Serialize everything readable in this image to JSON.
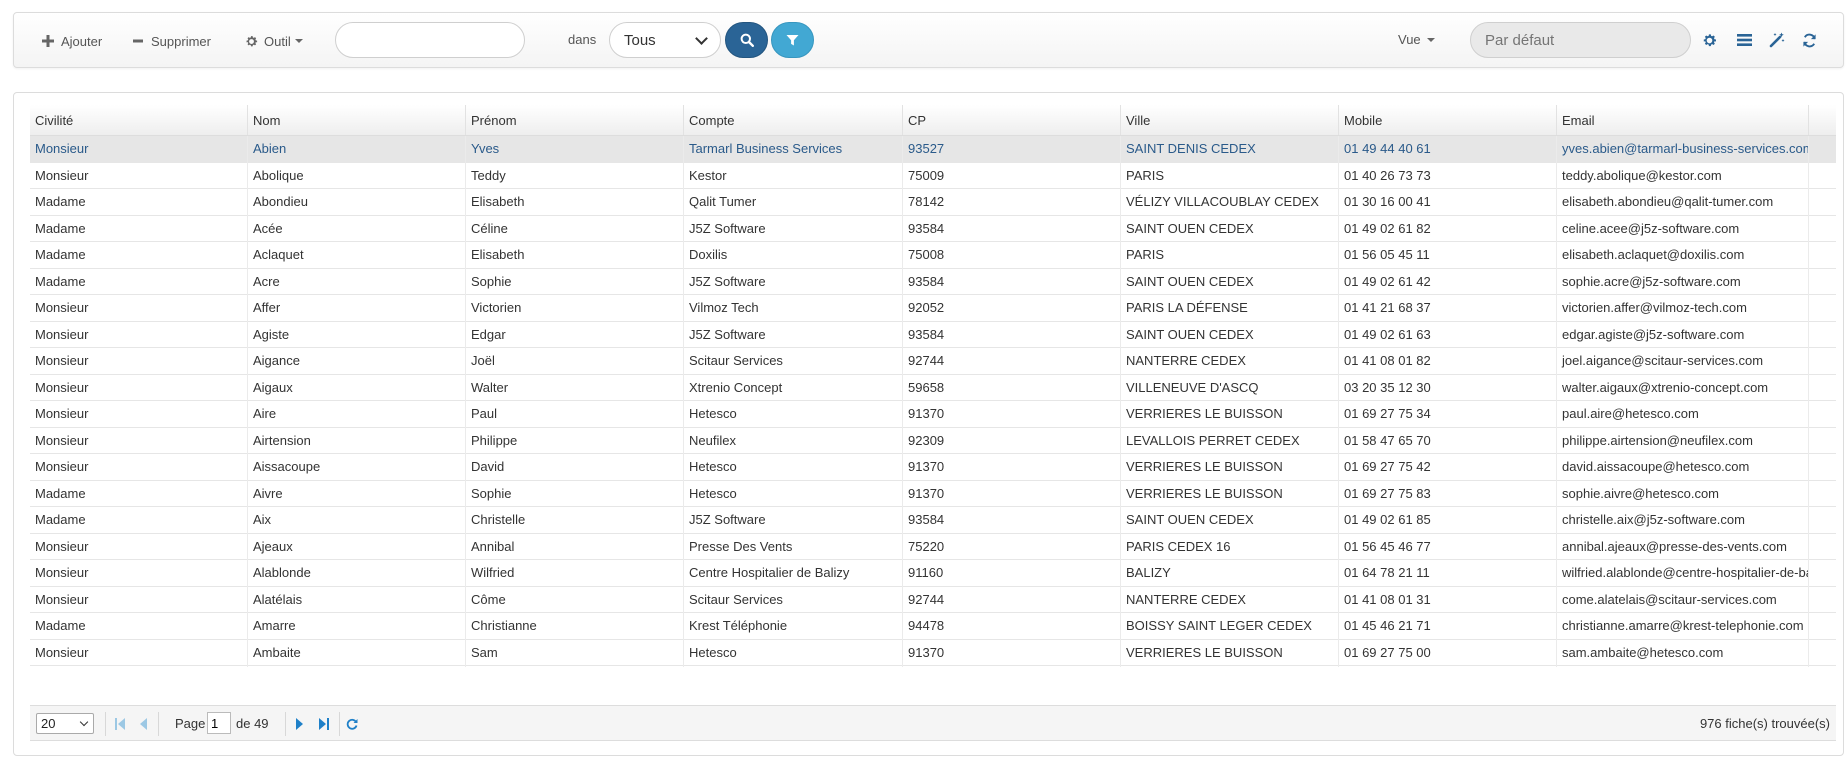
{
  "toolbar": {
    "add_label": "Ajouter",
    "delete_label": "Supprimer",
    "tool_label": "Outil",
    "search_value": "",
    "search_placeholder": "",
    "in_label": "dans",
    "scope_selected": "Tous",
    "view_label": "Vue",
    "view_placeholder": "Par défaut",
    "icons": [
      "plus-icon",
      "minus-icon",
      "gear-icon",
      "search-icon",
      "filter-icon",
      "settings-icon",
      "list-icon",
      "magic-wand-icon",
      "refresh-icon"
    ],
    "colors": {
      "search_button": "#2a6496",
      "filter_button": "#42a8d3",
      "icon_blue": "#2a6496"
    }
  },
  "grid": {
    "columns": [
      "Civilité",
      "Nom",
      "Prénom",
      "Compte",
      "CP",
      "Ville",
      "Mobile",
      "Email"
    ],
    "rows": [
      [
        "Monsieur",
        "Abien",
        "Yves",
        "Tarmarl Business Services",
        "93527",
        "SAINT DENIS CEDEX",
        "01 49 44 40 61",
        "yves.abien@tarmarl-business-services.com"
      ],
      [
        "Monsieur",
        "Abolique",
        "Teddy",
        "Kestor",
        "75009",
        "PARIS",
        "01 40 26 73 73",
        "teddy.abolique@kestor.com"
      ],
      [
        "Madame",
        "Abondieu",
        "Elisabeth",
        "Qalit Tumer",
        "78142",
        "VÉLIZY VILLACOUBLAY CEDEX",
        "01 30 16 00 41",
        "elisabeth.abondieu@qalit-tumer.com"
      ],
      [
        "Madame",
        "Acée",
        "Céline",
        "J5Z Software",
        "93584",
        "SAINT OUEN CEDEX",
        "01 49 02 61 82",
        "celine.acee@j5z-software.com"
      ],
      [
        "Madame",
        "Aclaquet",
        "Elisabeth",
        "Doxilis",
        "75008",
        "PARIS",
        "01 56 05 45 11",
        "elisabeth.aclaquet@doxilis.com"
      ],
      [
        "Madame",
        "Acre",
        "Sophie",
        "J5Z Software",
        "93584",
        "SAINT OUEN CEDEX",
        "01 49 02 61 42",
        "sophie.acre@j5z-software.com"
      ],
      [
        "Monsieur",
        "Affer",
        "Victorien",
        "Vilmoz Tech",
        "92052",
        "PARIS LA DÉFENSE",
        "01 41 21 68 37",
        "victorien.affer@vilmoz-tech.com"
      ],
      [
        "Monsieur",
        "Agiste",
        "Edgar",
        "J5Z Software",
        "93584",
        "SAINT OUEN CEDEX",
        "01 49 02 61 63",
        "edgar.agiste@j5z-software.com"
      ],
      [
        "Monsieur",
        "Aigance",
        "Joël",
        "Scitaur Services",
        "92744",
        "NANTERRE CEDEX",
        "01 41 08 01 82",
        "joel.aigance@scitaur-services.com"
      ],
      [
        "Monsieur",
        "Aigaux",
        "Walter",
        "Xtrenio Concept",
        "59658",
        "VILLENEUVE D'ASCQ",
        "03 20 35 12 30",
        "walter.aigaux@xtrenio-concept.com"
      ],
      [
        "Monsieur",
        "Aire",
        "Paul",
        "Hetesco",
        "91370",
        "VERRIERES LE BUISSON",
        "01 69 27 75 34",
        "paul.aire@hetesco.com"
      ],
      [
        "Monsieur",
        "Airtension",
        "Philippe",
        "Neufilex",
        "92309",
        "LEVALLOIS PERRET CEDEX",
        "01 58 47 65 70",
        "philippe.airtension@neufilex.com"
      ],
      [
        "Monsieur",
        "Aissacoupe",
        "David",
        "Hetesco",
        "91370",
        "VERRIERES LE BUISSON",
        "01 69 27 75 42",
        "david.aissacoupe@hetesco.com"
      ],
      [
        "Madame",
        "Aivre",
        "Sophie",
        "Hetesco",
        "91370",
        "VERRIERES LE BUISSON",
        "01 69 27 75 83",
        "sophie.aivre@hetesco.com"
      ],
      [
        "Madame",
        "Aix",
        "Christelle",
        "J5Z Software",
        "93584",
        "SAINT OUEN CEDEX",
        "01 49 02 61 85",
        "christelle.aix@j5z-software.com"
      ],
      [
        "Monsieur",
        "Ajeaux",
        "Annibal",
        "Presse Des Vents",
        "75220",
        "PARIS CEDEX 16",
        "01 56 45 46 77",
        "annibal.ajeaux@presse-des-vents.com"
      ],
      [
        "Monsieur",
        "Alablonde",
        "Wilfried",
        "Centre Hospitalier de Balizy",
        "91160",
        "BALIZY",
        "01 64 78 21 11",
        "wilfried.alablonde@centre-hospitalier-de-balizy.com"
      ],
      [
        "Monsieur",
        "Alatélais",
        "Côme",
        "Scitaur Services",
        "92744",
        "NANTERRE CEDEX",
        "01 41 08 01 31",
        "come.alatelais@scitaur-services.com"
      ],
      [
        "Madame",
        "Amarre",
        "Christianne",
        "Krest Téléphonie",
        "94478",
        "BOISSY SAINT LEGER CEDEX",
        "01 45 46 21 71",
        "christianne.amarre@krest-telephonie.com"
      ],
      [
        "Monsieur",
        "Ambaite",
        "Sam",
        "Hetesco",
        "91370",
        "VERRIERES LE BUISSON",
        "01 69 27 75 00",
        "sam.ambaite@hetesco.com"
      ]
    ],
    "selected_row": 0
  },
  "pager": {
    "page_size": "20",
    "page_label": "Page",
    "page_value": "1",
    "of_label": "de 49",
    "total_label": "976 fiche(s) trouvée(s)"
  }
}
